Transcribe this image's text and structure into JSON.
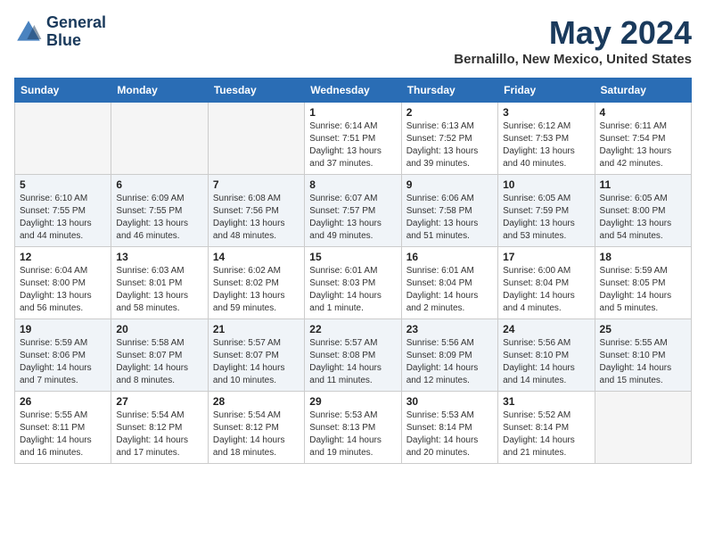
{
  "header": {
    "logo_line1": "General",
    "logo_line2": "Blue",
    "title": "May 2024",
    "subtitle": "Bernalillo, New Mexico, United States"
  },
  "weekdays": [
    "Sunday",
    "Monday",
    "Tuesday",
    "Wednesday",
    "Thursday",
    "Friday",
    "Saturday"
  ],
  "weeks": [
    [
      {
        "day": "",
        "sunrise": "",
        "sunset": "",
        "daylight": ""
      },
      {
        "day": "",
        "sunrise": "",
        "sunset": "",
        "daylight": ""
      },
      {
        "day": "",
        "sunrise": "",
        "sunset": "",
        "daylight": ""
      },
      {
        "day": "1",
        "sunrise": "Sunrise: 6:14 AM",
        "sunset": "Sunset: 7:51 PM",
        "daylight": "Daylight: 13 hours and 37 minutes."
      },
      {
        "day": "2",
        "sunrise": "Sunrise: 6:13 AM",
        "sunset": "Sunset: 7:52 PM",
        "daylight": "Daylight: 13 hours and 39 minutes."
      },
      {
        "day": "3",
        "sunrise": "Sunrise: 6:12 AM",
        "sunset": "Sunset: 7:53 PM",
        "daylight": "Daylight: 13 hours and 40 minutes."
      },
      {
        "day": "4",
        "sunrise": "Sunrise: 6:11 AM",
        "sunset": "Sunset: 7:54 PM",
        "daylight": "Daylight: 13 hours and 42 minutes."
      }
    ],
    [
      {
        "day": "5",
        "sunrise": "Sunrise: 6:10 AM",
        "sunset": "Sunset: 7:55 PM",
        "daylight": "Daylight: 13 hours and 44 minutes."
      },
      {
        "day": "6",
        "sunrise": "Sunrise: 6:09 AM",
        "sunset": "Sunset: 7:55 PM",
        "daylight": "Daylight: 13 hours and 46 minutes."
      },
      {
        "day": "7",
        "sunrise": "Sunrise: 6:08 AM",
        "sunset": "Sunset: 7:56 PM",
        "daylight": "Daylight: 13 hours and 48 minutes."
      },
      {
        "day": "8",
        "sunrise": "Sunrise: 6:07 AM",
        "sunset": "Sunset: 7:57 PM",
        "daylight": "Daylight: 13 hours and 49 minutes."
      },
      {
        "day": "9",
        "sunrise": "Sunrise: 6:06 AM",
        "sunset": "Sunset: 7:58 PM",
        "daylight": "Daylight: 13 hours and 51 minutes."
      },
      {
        "day": "10",
        "sunrise": "Sunrise: 6:05 AM",
        "sunset": "Sunset: 7:59 PM",
        "daylight": "Daylight: 13 hours and 53 minutes."
      },
      {
        "day": "11",
        "sunrise": "Sunrise: 6:05 AM",
        "sunset": "Sunset: 8:00 PM",
        "daylight": "Daylight: 13 hours and 54 minutes."
      }
    ],
    [
      {
        "day": "12",
        "sunrise": "Sunrise: 6:04 AM",
        "sunset": "Sunset: 8:00 PM",
        "daylight": "Daylight: 13 hours and 56 minutes."
      },
      {
        "day": "13",
        "sunrise": "Sunrise: 6:03 AM",
        "sunset": "Sunset: 8:01 PM",
        "daylight": "Daylight: 13 hours and 58 minutes."
      },
      {
        "day": "14",
        "sunrise": "Sunrise: 6:02 AM",
        "sunset": "Sunset: 8:02 PM",
        "daylight": "Daylight: 13 hours and 59 minutes."
      },
      {
        "day": "15",
        "sunrise": "Sunrise: 6:01 AM",
        "sunset": "Sunset: 8:03 PM",
        "daylight": "Daylight: 14 hours and 1 minute."
      },
      {
        "day": "16",
        "sunrise": "Sunrise: 6:01 AM",
        "sunset": "Sunset: 8:04 PM",
        "daylight": "Daylight: 14 hours and 2 minutes."
      },
      {
        "day": "17",
        "sunrise": "Sunrise: 6:00 AM",
        "sunset": "Sunset: 8:04 PM",
        "daylight": "Daylight: 14 hours and 4 minutes."
      },
      {
        "day": "18",
        "sunrise": "Sunrise: 5:59 AM",
        "sunset": "Sunset: 8:05 PM",
        "daylight": "Daylight: 14 hours and 5 minutes."
      }
    ],
    [
      {
        "day": "19",
        "sunrise": "Sunrise: 5:59 AM",
        "sunset": "Sunset: 8:06 PM",
        "daylight": "Daylight: 14 hours and 7 minutes."
      },
      {
        "day": "20",
        "sunrise": "Sunrise: 5:58 AM",
        "sunset": "Sunset: 8:07 PM",
        "daylight": "Daylight: 14 hours and 8 minutes."
      },
      {
        "day": "21",
        "sunrise": "Sunrise: 5:57 AM",
        "sunset": "Sunset: 8:07 PM",
        "daylight": "Daylight: 14 hours and 10 minutes."
      },
      {
        "day": "22",
        "sunrise": "Sunrise: 5:57 AM",
        "sunset": "Sunset: 8:08 PM",
        "daylight": "Daylight: 14 hours and 11 minutes."
      },
      {
        "day": "23",
        "sunrise": "Sunrise: 5:56 AM",
        "sunset": "Sunset: 8:09 PM",
        "daylight": "Daylight: 14 hours and 12 minutes."
      },
      {
        "day": "24",
        "sunrise": "Sunrise: 5:56 AM",
        "sunset": "Sunset: 8:10 PM",
        "daylight": "Daylight: 14 hours and 14 minutes."
      },
      {
        "day": "25",
        "sunrise": "Sunrise: 5:55 AM",
        "sunset": "Sunset: 8:10 PM",
        "daylight": "Daylight: 14 hours and 15 minutes."
      }
    ],
    [
      {
        "day": "26",
        "sunrise": "Sunrise: 5:55 AM",
        "sunset": "Sunset: 8:11 PM",
        "daylight": "Daylight: 14 hours and 16 minutes."
      },
      {
        "day": "27",
        "sunrise": "Sunrise: 5:54 AM",
        "sunset": "Sunset: 8:12 PM",
        "daylight": "Daylight: 14 hours and 17 minutes."
      },
      {
        "day": "28",
        "sunrise": "Sunrise: 5:54 AM",
        "sunset": "Sunset: 8:12 PM",
        "daylight": "Daylight: 14 hours and 18 minutes."
      },
      {
        "day": "29",
        "sunrise": "Sunrise: 5:53 AM",
        "sunset": "Sunset: 8:13 PM",
        "daylight": "Daylight: 14 hours and 19 minutes."
      },
      {
        "day": "30",
        "sunrise": "Sunrise: 5:53 AM",
        "sunset": "Sunset: 8:14 PM",
        "daylight": "Daylight: 14 hours and 20 minutes."
      },
      {
        "day": "31",
        "sunrise": "Sunrise: 5:52 AM",
        "sunset": "Sunset: 8:14 PM",
        "daylight": "Daylight: 14 hours and 21 minutes."
      },
      {
        "day": "",
        "sunrise": "",
        "sunset": "",
        "daylight": ""
      }
    ]
  ]
}
